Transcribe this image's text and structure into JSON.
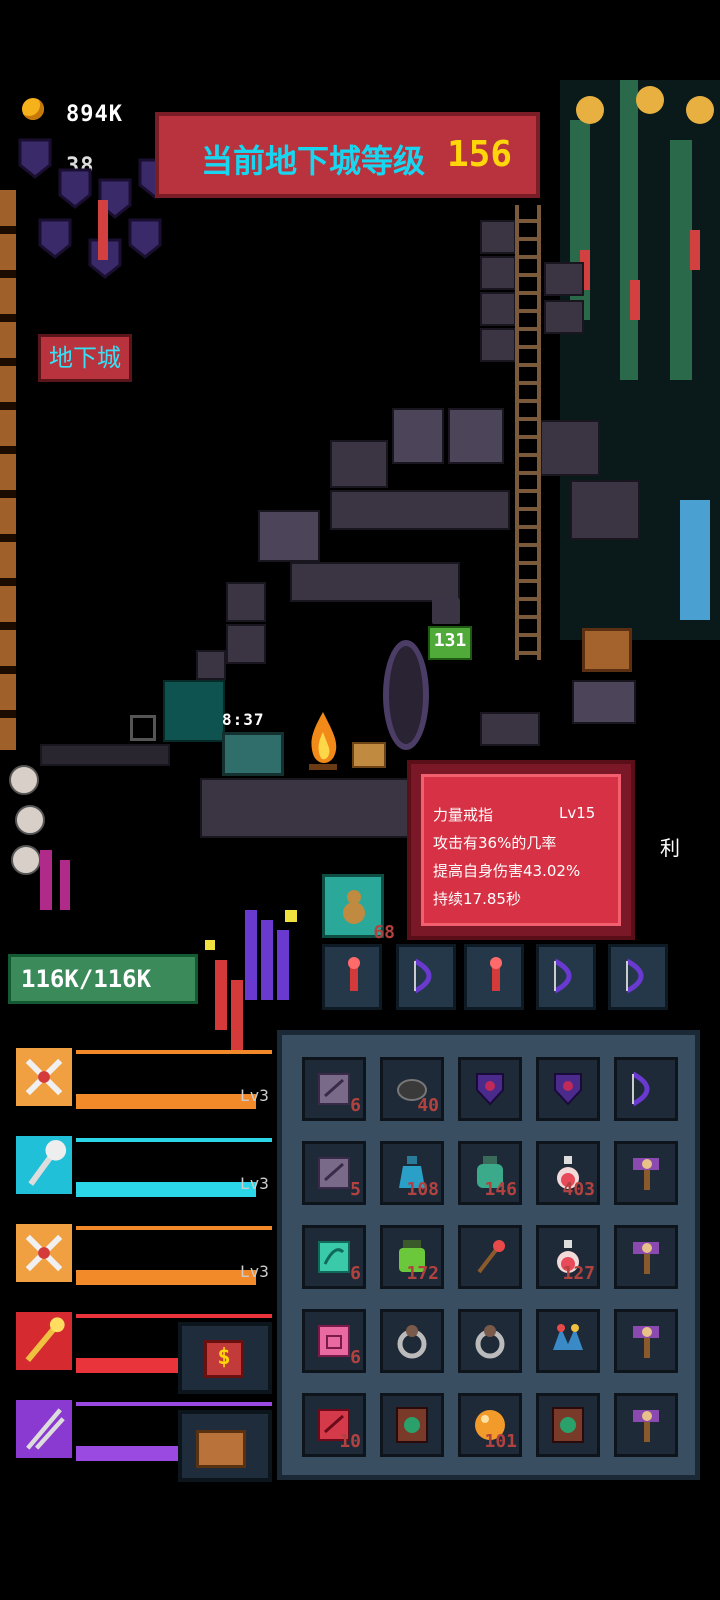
{
  "hud": {
    "gold": "894K",
    "gems": "38",
    "dungeon_level_label": "当前地下城等级",
    "dungeon_level_value": "156",
    "dungeon_button": "地下城"
  },
  "scene": {
    "cat_level": "131",
    "chest_timer": "8:37"
  },
  "tooltip": {
    "item_name": "力量戒指",
    "item_level": "Lv15",
    "line1": "攻击有36%的几率",
    "line2": "提高自身伤害43.02%",
    "line3": "持续17.85秒",
    "side_text": "利"
  },
  "player": {
    "hp": "116K/116K"
  },
  "equipped": {
    "teal_count": "68"
  },
  "skills": [
    {
      "icon": "crossed-swords-icon",
      "level_label": "Lv3",
      "bar_color": "#f28a2a",
      "frame": "#f0a040"
    },
    {
      "icon": "mace-icon",
      "level_label": "Lv3",
      "bar_color": "#2ad6e8",
      "frame": "#20c0d8"
    },
    {
      "icon": "crossed-swords-icon",
      "level_label": "Lv3",
      "bar_color": "#f28a2a",
      "frame": "#f0a040"
    },
    {
      "icon": "scepter-icon",
      "level_label": "",
      "bar_color": "#e8343a",
      "frame": "#d42a30"
    },
    {
      "icon": "spear-icon",
      "level_label": "",
      "bar_color": "#9a4ae0",
      "frame": "#8a3ad0"
    }
  ],
  "inventory": {
    "rows": [
      [
        {
          "icon": "scroll-icon",
          "count": "6"
        },
        {
          "icon": "stone-icon",
          "count": "40"
        },
        {
          "icon": "shield-icon",
          "count": ""
        },
        {
          "icon": "shield-icon",
          "count": ""
        },
        {
          "icon": "bow-icon",
          "count": ""
        }
      ],
      [
        {
          "icon": "scroll-icon",
          "count": "5"
        },
        {
          "icon": "blue-potion-icon",
          "count": "108"
        },
        {
          "icon": "jar-icon",
          "count": "146"
        },
        {
          "icon": "red-potion-icon",
          "count": "403"
        },
        {
          "icon": "axe-icon",
          "count": ""
        }
      ],
      [
        {
          "icon": "green-scroll-icon",
          "count": "6"
        },
        {
          "icon": "green-jar-icon",
          "count": "172"
        },
        {
          "icon": "staff-icon",
          "count": ""
        },
        {
          "icon": "red-potion-icon",
          "count": "127"
        },
        {
          "icon": "axe-icon",
          "count": ""
        }
      ],
      [
        {
          "icon": "pink-scroll-icon",
          "count": "6"
        },
        {
          "icon": "ring-icon",
          "count": ""
        },
        {
          "icon": "ring-icon",
          "count": ""
        },
        {
          "icon": "jester-hat-icon",
          "count": ""
        },
        {
          "icon": "axe-icon",
          "count": ""
        }
      ],
      [
        {
          "icon": "red-book-icon",
          "count": "10"
        },
        {
          "icon": "spellbook-icon",
          "count": ""
        },
        {
          "icon": "orb-icon",
          "count": "101"
        },
        {
          "icon": "spellbook-icon",
          "count": ""
        },
        {
          "icon": "axe-icon",
          "count": ""
        }
      ]
    ]
  },
  "buttons": {
    "shop_symbol": "$"
  }
}
